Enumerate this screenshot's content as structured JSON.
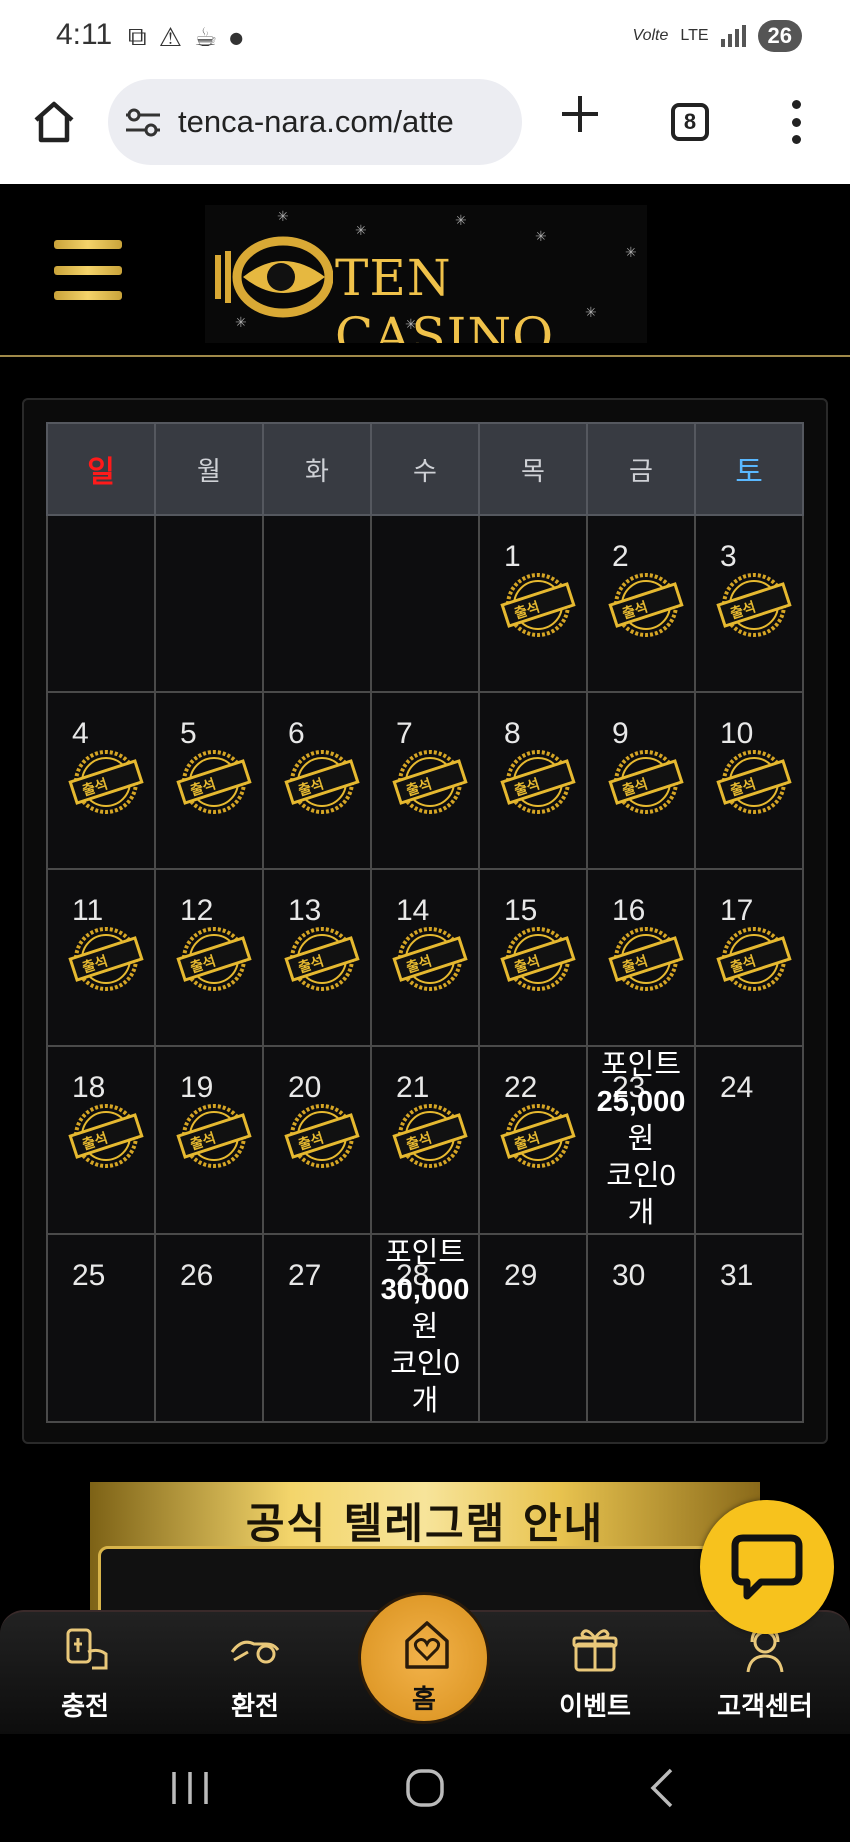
{
  "status_bar": {
    "time": "4:11",
    "network": "LTE",
    "carrier_tag": "Volte",
    "battery": "26",
    "left_icons": [
      "screenshot-icon",
      "alert-icon",
      "app-icon",
      "dot"
    ]
  },
  "browser": {
    "url": "tenca-nara.com/atte",
    "tab_count": "8"
  },
  "site": {
    "logo_text": "TEN CASINO"
  },
  "calendar": {
    "weekdays": [
      "일",
      "월",
      "화",
      "수",
      "목",
      "금",
      "토"
    ],
    "rows": [
      [
        {
          "day": "",
          "stamp": false
        },
        {
          "day": "",
          "stamp": false
        },
        {
          "day": "",
          "stamp": false
        },
        {
          "day": "",
          "stamp": false
        },
        {
          "day": "1",
          "stamp": true
        },
        {
          "day": "2",
          "stamp": true
        },
        {
          "day": "3",
          "stamp": true
        }
      ],
      [
        {
          "day": "4",
          "stamp": true
        },
        {
          "day": "5",
          "stamp": true
        },
        {
          "day": "6",
          "stamp": true
        },
        {
          "day": "7",
          "stamp": true
        },
        {
          "day": "8",
          "stamp": true
        },
        {
          "day": "9",
          "stamp": true
        },
        {
          "day": "10",
          "stamp": true
        }
      ],
      [
        {
          "day": "11",
          "stamp": true
        },
        {
          "day": "12",
          "stamp": true
        },
        {
          "day": "13",
          "stamp": true
        },
        {
          "day": "14",
          "stamp": true
        },
        {
          "day": "15",
          "stamp": true
        },
        {
          "day": "16",
          "stamp": true
        },
        {
          "day": "17",
          "stamp": true
        }
      ],
      [
        {
          "day": "18",
          "stamp": true
        },
        {
          "day": "19",
          "stamp": true
        },
        {
          "day": "20",
          "stamp": true
        },
        {
          "day": "21",
          "stamp": true
        },
        {
          "day": "22",
          "stamp": true
        },
        {
          "day": "23",
          "stamp": false,
          "reward": {
            "line1": "포인트",
            "amount": "25,000",
            "line3": "원",
            "line4": "코인0",
            "line5": "개"
          }
        },
        {
          "day": "24",
          "stamp": false
        }
      ],
      [
        {
          "day": "25",
          "stamp": false
        },
        {
          "day": "26",
          "stamp": false
        },
        {
          "day": "27",
          "stamp": false
        },
        {
          "day": "28",
          "stamp": false,
          "reward": {
            "line1": "포인트",
            "amount": "30,000",
            "line3": "원",
            "line4": "코인0",
            "line5": "개"
          }
        },
        {
          "day": "29",
          "stamp": false
        },
        {
          "day": "30",
          "stamp": false
        },
        {
          "day": "31",
          "stamp": false
        }
      ]
    ],
    "stamp_label": "출석"
  },
  "banner": {
    "title": "공식 텔레그램 안내"
  },
  "bottom_nav": {
    "items": [
      {
        "label": "충전",
        "icon": "deposit-icon"
      },
      {
        "label": "환전",
        "icon": "withdraw-icon"
      },
      {
        "label": "이벤트",
        "icon": "gift-icon"
      },
      {
        "label": "고객센터",
        "icon": "support-icon"
      }
    ],
    "home_label": "홈"
  },
  "colors": {
    "gold": "#f0c24a",
    "sunday": "#ff1a1a",
    "saturday": "#5ab8ff",
    "chat": "#f7c21d",
    "home_fab": "#e3a131"
  }
}
